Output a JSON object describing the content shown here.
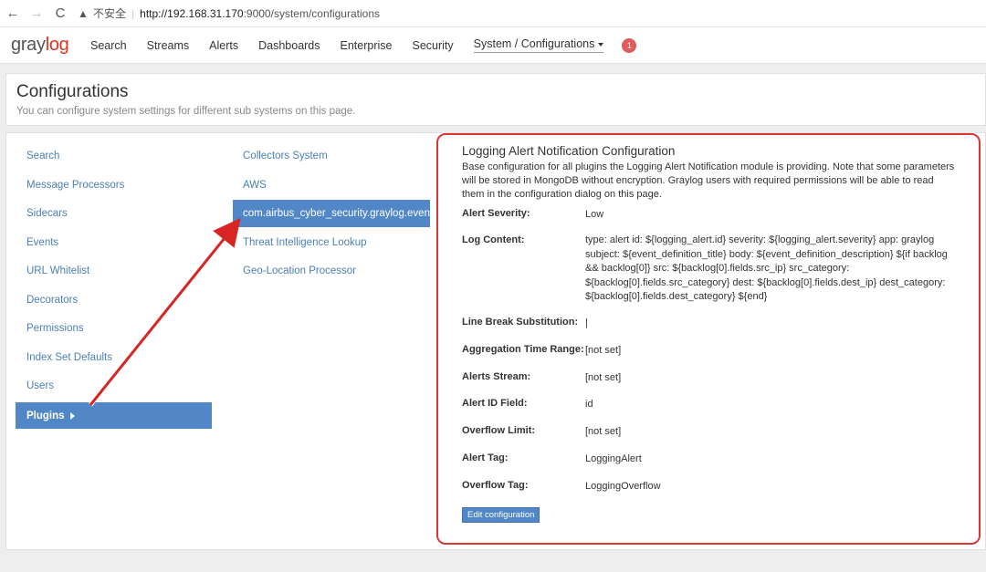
{
  "browser": {
    "back": "←",
    "forward": "→",
    "reload": "C",
    "warn_icon": "▲",
    "insecure_label": "不安全",
    "url_host": "http://192.168.31.170",
    "url_path": ":9000/system/configurations"
  },
  "header": {
    "brand_left": "gray",
    "brand_right": "log",
    "nav": [
      "Search",
      "Streams",
      "Alerts",
      "Dashboards",
      "Enterprise",
      "Security"
    ],
    "active_nav": "System / Configurations",
    "notification_count": "1"
  },
  "page": {
    "title": "Configurations",
    "description": "You can configure system settings for different sub systems on this page."
  },
  "menu": {
    "items": [
      "Search",
      "Message Processors",
      "Sidecars",
      "Events",
      "URL Whitelist",
      "Decorators",
      "Permissions",
      "Index Set Defaults",
      "Users"
    ],
    "active": "Plugins"
  },
  "submenu": {
    "items": [
      "Collectors System",
      "AWS",
      "com.airbus_cyber_security.graylog.events.config",
      "Threat Intelligence Lookup",
      "Geo-Location Processor"
    ],
    "active_index": 2
  },
  "config": {
    "title": "Logging Alert Notification Configuration",
    "description": "Base configuration for all plugins the Logging Alert Notification module is providing. Note that some parameters will be stored in MongoDB without encryption. Graylog users with required permissions will be able to read them in the configuration dialog on this page.",
    "fields": [
      {
        "label": "Alert Severity:",
        "value": "Low"
      },
      {
        "label": "Log Content:",
        "value": "type: alert id: ${logging_alert.id} severity: ${logging_alert.severity} app: graylog subject: ${event_definition_title} body: ${event_definition_description} ${if backlog && backlog[0]} src: ${backlog[0].fields.src_ip} src_category: ${backlog[0].fields.src_category} dest: ${backlog[0].fields.dest_ip} dest_category: ${backlog[0].fields.dest_category} ${end}"
      },
      {
        "label": "Line Break Substitution:",
        "value": "|"
      },
      {
        "label": "Aggregation Time Range:",
        "value": "[not set]"
      },
      {
        "label": "Alerts Stream:",
        "value": "[not set]"
      },
      {
        "label": "Alert ID Field:",
        "value": "id"
      },
      {
        "label": "Overflow Limit:",
        "value": "[not set]"
      },
      {
        "label": "Alert Tag:",
        "value": "LoggingAlert"
      },
      {
        "label": "Overflow Tag:",
        "value": "LoggingOverflow"
      }
    ],
    "edit_button": "Edit configuration"
  },
  "colors": {
    "accent": "#5187c6",
    "highlight_border": "#d93636",
    "link": "#4b7fb5"
  }
}
